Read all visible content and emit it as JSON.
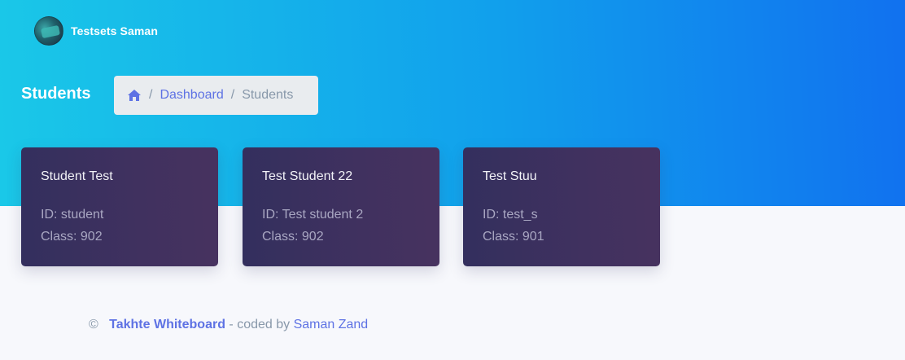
{
  "user": {
    "name": "Testsets Saman"
  },
  "header": {
    "title": "Students"
  },
  "breadcrumb": {
    "items": [
      "Dashboard",
      "Students"
    ],
    "separator": "/"
  },
  "students": [
    {
      "name": "Student Test",
      "id": "ID: student",
      "class": "Class: 902"
    },
    {
      "name": "Test Student 22",
      "id": "ID: Test student 2",
      "class": "Class: 902"
    },
    {
      "name": "Test Stuu",
      "id": "ID: test_s",
      "class": "Class: 901"
    }
  ],
  "footer": {
    "copyright": "©",
    "brand": "Takhte Whiteboard",
    "middle": "- coded by",
    "author": "Saman Zand"
  },
  "colors": {
    "header_gradient_start": "#1ac8e8",
    "header_gradient_end": "#1171ef",
    "accent": "#5e72e4",
    "card_start": "#332f5e",
    "card_end": "#47325f"
  }
}
